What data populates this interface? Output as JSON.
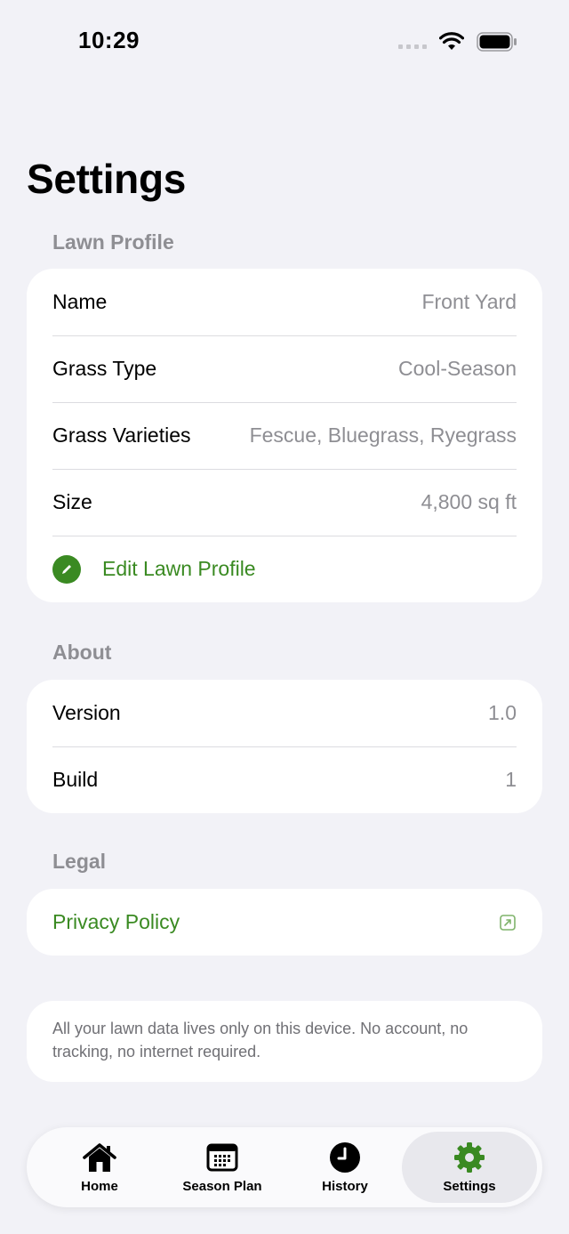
{
  "status_bar": {
    "time": "10:29"
  },
  "page": {
    "title": "Settings"
  },
  "lawn_profile": {
    "header": "Lawn Profile",
    "rows": [
      {
        "label": "Name",
        "value": "Front Yard"
      },
      {
        "label": "Grass Type",
        "value": "Cool-Season"
      },
      {
        "label": "Grass Varieties",
        "value": "Fescue, Bluegrass, Ryegrass"
      },
      {
        "label": "Size",
        "value": "4,800 sq ft"
      }
    ],
    "edit_label": "Edit Lawn Profile"
  },
  "about": {
    "header": "About",
    "rows": [
      {
        "label": "Version",
        "value": "1.0"
      },
      {
        "label": "Build",
        "value": "1"
      }
    ]
  },
  "legal": {
    "header": "Legal",
    "privacy_label": "Privacy Policy"
  },
  "note": "All your lawn data lives only on this device. No account, no tracking, no internet required.",
  "tab_bar": {
    "tabs": [
      {
        "label": "Home",
        "icon": "house-icon"
      },
      {
        "label": "Season Plan",
        "icon": "calendar-icon"
      },
      {
        "label": "History",
        "icon": "clock-icon"
      },
      {
        "label": "Settings",
        "icon": "gear-icon",
        "active": true
      }
    ]
  },
  "colors": {
    "accent": "#3a8a22",
    "background": "#f2f2f7",
    "secondary_text": "#8e8e93"
  }
}
